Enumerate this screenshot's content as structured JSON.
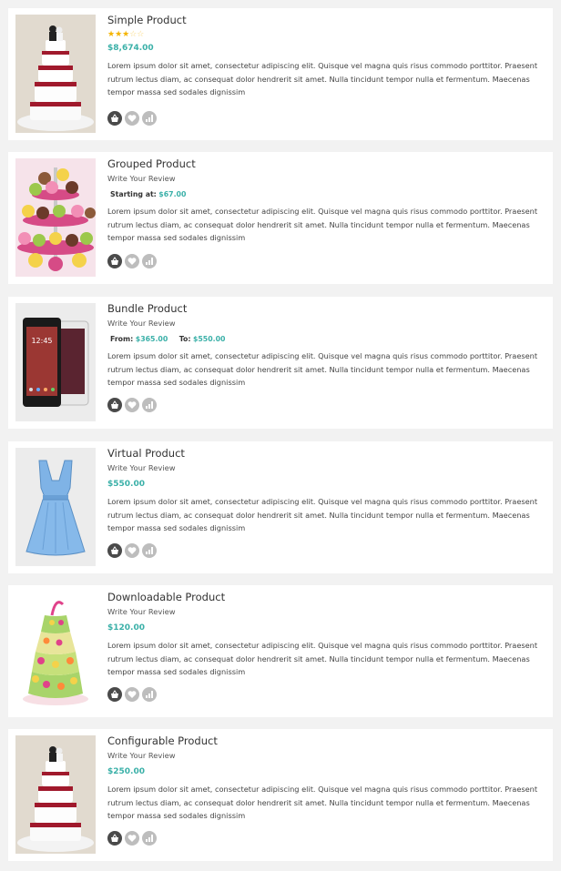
{
  "products": [
    {
      "title": "Simple Product",
      "rating": 3,
      "rating_max": 5,
      "price": "$8,674.00",
      "description": "Lorem ipsum dolor sit amet, consectetur adipiscing elit. Quisque vel magna quis risus commodo porttitor. Praesent rutrum lectus diam, ac consequat dolor hendrerit sit amet. Nulla tincidunt tempor nulla et fermentum. Maecenas tempor massa sed sodales dignissim",
      "image": "wedding-cake"
    },
    {
      "title": "Grouped Product",
      "review_link": "Write Your Review",
      "price_label": "Starting at:",
      "price": "$67.00",
      "description": "Lorem ipsum dolor sit amet, consectetur adipiscing elit. Quisque vel magna quis risus commodo porttitor. Praesent rutrum lectus diam, ac consequat dolor hendrerit sit amet. Nulla tincidunt tempor nulla et fermentum. Maecenas tempor massa sed sodales dignissim",
      "image": "cupcakes"
    },
    {
      "title": "Bundle Product",
      "review_link": "Write Your Review",
      "from_label": "From:",
      "from_price": "$365.00",
      "to_label": "To:",
      "to_price": "$550.00",
      "description": "Lorem ipsum dolor sit amet, consectetur adipiscing elit. Quisque vel magna quis risus commodo porttitor. Praesent rutrum lectus diam, ac consequat dolor hendrerit sit amet. Nulla tincidunt tempor nulla et fermentum. Maecenas tempor massa sed sodales dignissim",
      "image": "smartphone"
    },
    {
      "title": "Virtual Product",
      "review_link": "Write Your Review",
      "price": "$550.00",
      "description": "Lorem ipsum dolor sit amet, consectetur adipiscing elit. Quisque vel magna quis risus commodo porttitor. Praesent rutrum lectus diam, ac consequat dolor hendrerit sit amet. Nulla tincidunt tempor nulla et fermentum. Maecenas tempor massa sed sodales dignissim",
      "image": "blue-dress"
    },
    {
      "title": "Downloadable Product",
      "review_link": "Write Your Review",
      "price": "$120.00",
      "description": "Lorem ipsum dolor sit amet, consectetur adipiscing elit. Quisque vel magna quis risus commodo porttitor. Praesent rutrum lectus diam, ac consequat dolor hendrerit sit amet. Nulla tincidunt tempor nulla et fermentum. Maecenas tempor massa sed sodales dignissim",
      "image": "flower-cake"
    },
    {
      "title": "Configurable Product",
      "review_link": "Write Your Review",
      "price": "$250.00",
      "description": "Lorem ipsum dolor sit amet, consectetur adipiscing elit. Quisque vel magna quis risus commodo porttitor. Praesent rutrum lectus diam, ac consequat dolor hendrerit sit amet. Nulla tincidunt tempor nulla et fermentum. Maecenas tempor massa sed sodales dignissim",
      "image": "wedding-cake"
    }
  ],
  "action_icons": [
    "basket-icon",
    "heart-icon",
    "compare-icon"
  ],
  "colors": {
    "price": "#3ab0a8",
    "star": "#f4b400",
    "action_dark": "#4a4a4a",
    "action_light": "#bdbdbd"
  }
}
